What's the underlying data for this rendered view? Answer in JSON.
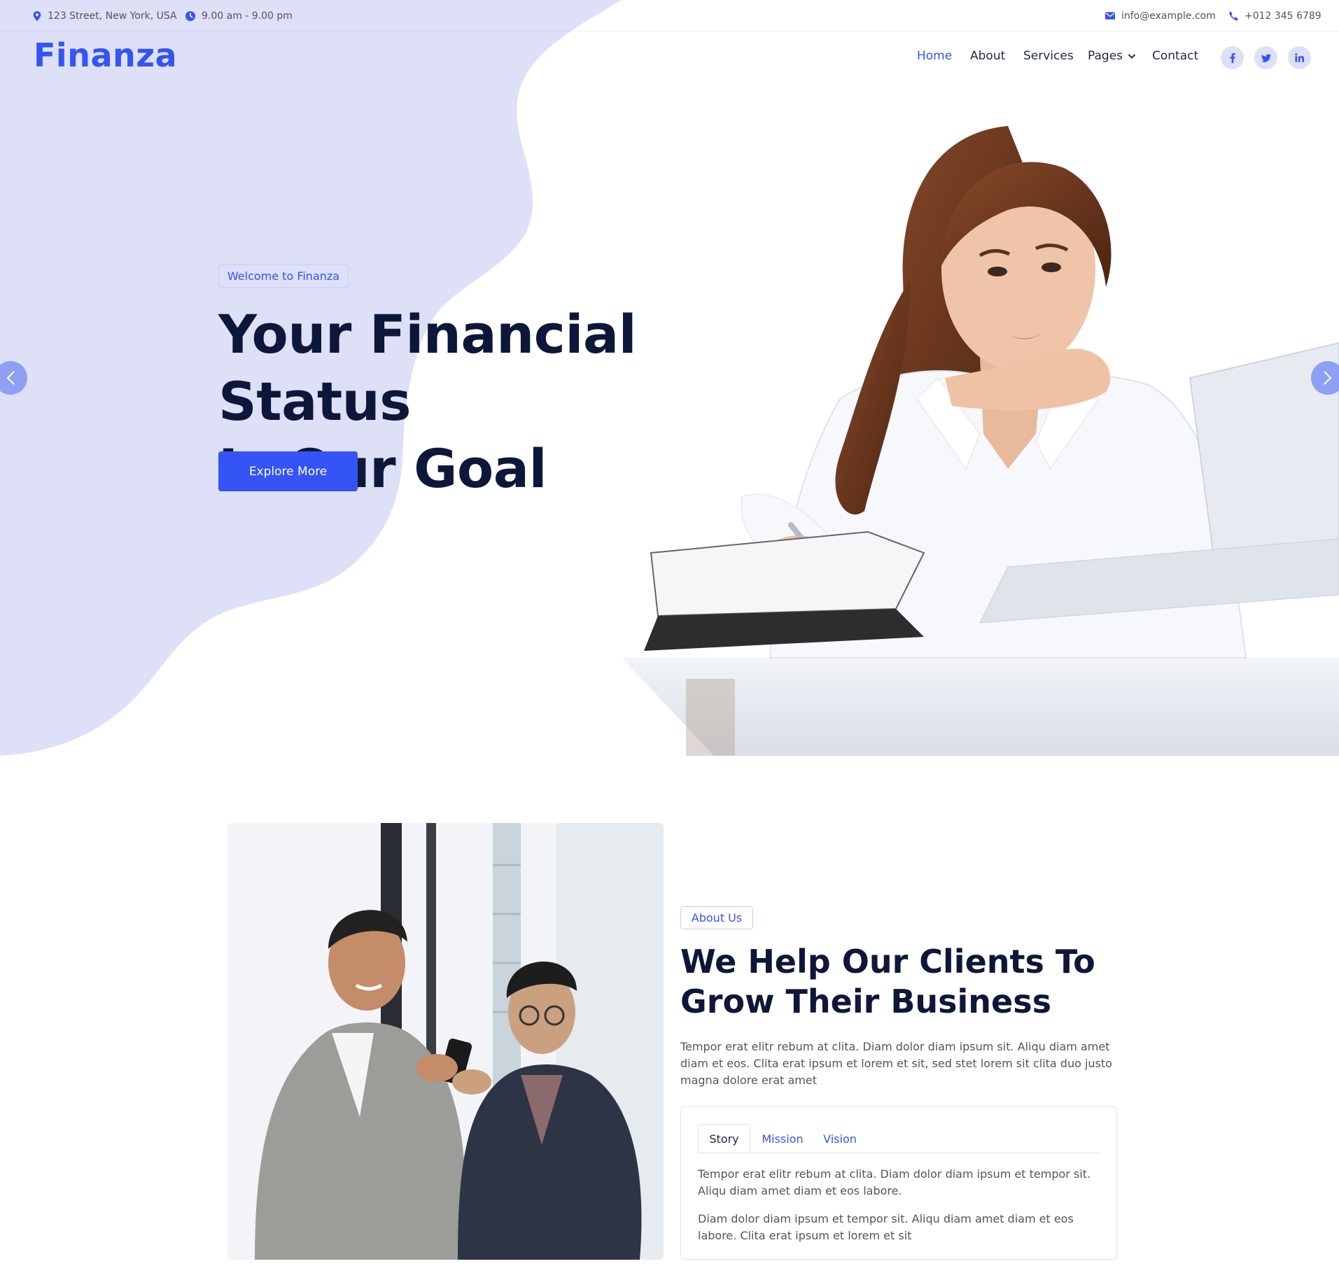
{
  "topbar": {
    "address": "123 Street, New York, USA",
    "hours": "9.00 am - 9.00 pm",
    "email": "info@example.com",
    "phone": "+012 345 6789"
  },
  "brand": "Finanza",
  "nav": {
    "items": [
      "Home",
      "About",
      "Services",
      "Pages",
      "Contact"
    ],
    "active": "Home"
  },
  "social": [
    "facebook-icon",
    "twitter-icon",
    "linkedin-icon"
  ],
  "hero": {
    "badge": "Welcome to Finanza",
    "title_line1": "Your Financial Status",
    "title_line2": "Is Our Goal",
    "button": "Explore More"
  },
  "about": {
    "badge": "About Us",
    "title_line1": "We Help Our Clients To",
    "title_line2": "Grow Their Business",
    "text": "Tempor erat elitr rebum at clita. Diam dolor diam ipsum sit. Aliqu diam amet diam et eos. Clita erat ipsum et lorem et sit, sed stet lorem sit clita duo justo magna dolore erat amet",
    "tabs": [
      "Story",
      "Mission",
      "Vision"
    ],
    "active_tab": "Story",
    "tab_p1": "Tempor erat elitr rebum at clita. Diam dolor diam ipsum et tempor sit. Aliqu diam amet diam et eos labore.",
    "tab_p2": "Diam dolor diam ipsum et tempor sit. Aliqu diam amet diam et eos labore. Clita erat ipsum et lorem et sit"
  },
  "colors": {
    "primary": "#3454f5",
    "blob": "#dde0f7",
    "heading": "#0c1739",
    "arrow_button": "#8da0f2"
  }
}
